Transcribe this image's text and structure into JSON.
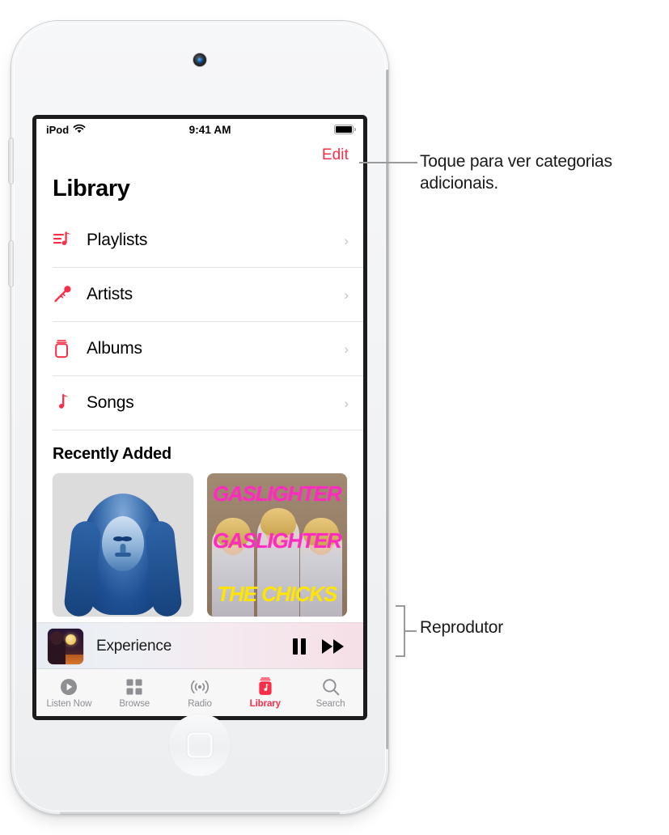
{
  "device": {
    "name": "iPod touch",
    "camera_icon": "front-camera",
    "home_button_icon": "home-button",
    "volume_up_icon": "volume-up-button",
    "volume_down_icon": "volume-down-button"
  },
  "status_bar": {
    "carrier": "iPod",
    "wifi_icon": "wifi-icon",
    "time": "9:41 AM",
    "battery_icon": "battery-full-icon"
  },
  "screen": {
    "edit_label": "Edit",
    "page_title": "Library",
    "library_items": [
      {
        "label": "Playlists",
        "icon": "playlists-icon",
        "chevron": "›"
      },
      {
        "label": "Artists",
        "icon": "microphone-icon",
        "chevron": "›"
      },
      {
        "label": "Albums",
        "icon": "albums-icon",
        "chevron": "›"
      },
      {
        "label": "Songs",
        "icon": "music-note-icon",
        "chevron": "›"
      }
    ],
    "recently_added_title": "Recently Added",
    "albums": [
      {
        "name": "album-artwork-blue-portrait",
        "alt": ""
      },
      {
        "name": "album-artwork-gaslighter",
        "line1": "GASLIGHTER",
        "line2": "GASLIGHTER",
        "line3": "THE CHICKS"
      }
    ]
  },
  "mini_player": {
    "artwork_icon": "now-playing-artwork",
    "track_title": "Experience",
    "pause_icon": "pause-icon",
    "next_icon": "fast-forward-icon"
  },
  "tab_bar": {
    "tabs": [
      {
        "label": "Listen Now",
        "icon": "play-circle-icon",
        "active": false
      },
      {
        "label": "Browse",
        "icon": "grid-icon",
        "active": false
      },
      {
        "label": "Radio",
        "icon": "broadcast-icon",
        "active": false
      },
      {
        "label": "Library",
        "icon": "library-icon",
        "active": true
      },
      {
        "label": "Search",
        "icon": "search-icon",
        "active": false
      }
    ]
  },
  "callouts": {
    "edit": "Toque para ver categorias adicionais.",
    "player": "Reprodutor"
  },
  "colors": {
    "accent_red": "#fa2d48",
    "inactive_gray": "#8e8e93",
    "separator": "#e3e3e5",
    "callout_line": "#9a9a9a",
    "artwork_pink": "#ff2bbf",
    "artwork_yellow": "#ffe500"
  }
}
